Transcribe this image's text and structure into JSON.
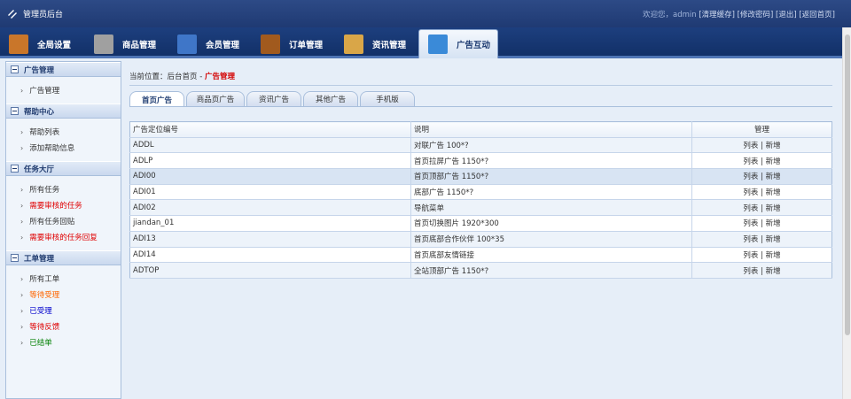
{
  "app": {
    "title": "管理员后台"
  },
  "toplinks": {
    "welcome": "欢迎您，admin",
    "clear_cache": "[清理缓存]",
    "change_pwd": "[修改密码]",
    "logout": "[退出]",
    "home": "[返回首页]"
  },
  "nav": {
    "tabs": [
      {
        "label": "全局设置",
        "icon": "house-icon",
        "color": "#c9762a"
      },
      {
        "label": "商品管理",
        "icon": "product-icon",
        "color": "#a0a0a0"
      },
      {
        "label": "会员管理",
        "icon": "member-card-icon",
        "color": "#3f76c8"
      },
      {
        "label": "订单管理",
        "icon": "briefcase-icon",
        "color": "#a15a1e"
      },
      {
        "label": "资讯管理",
        "icon": "folder-icon",
        "color": "#d9a648"
      },
      {
        "label": "广告互动",
        "icon": "window-icon",
        "color": "#3a8ad8"
      }
    ]
  },
  "sidebar": {
    "sections": [
      {
        "title": "广告管理",
        "items": [
          {
            "label": "广告管理",
            "color": "#333333"
          }
        ]
      },
      {
        "title": "帮助中心",
        "items": [
          {
            "label": "帮助列表",
            "color": "#333333"
          },
          {
            "label": "添加帮助信息",
            "color": "#333333"
          }
        ]
      },
      {
        "title": "任务大厅",
        "items": [
          {
            "label": "所有任务",
            "color": "#333333"
          },
          {
            "label": "需要审核的任务",
            "color": "#e00000"
          },
          {
            "label": "所有任务回贴",
            "color": "#333333"
          },
          {
            "label": "需要审核的任务回复",
            "color": "#e00000"
          }
        ]
      },
      {
        "title": "工单管理",
        "items": [
          {
            "label": "所有工单",
            "color": "#333333"
          },
          {
            "label": "等待受理",
            "color": "#ff6600"
          },
          {
            "label": "已受理",
            "color": "#0000cc"
          },
          {
            "label": "等待反馈",
            "color": "#e00000"
          },
          {
            "label": "已结单",
            "color": "#008000"
          }
        ]
      }
    ]
  },
  "breadcrumb": {
    "prefix": "当前位置：后台首页 - ",
    "current": "广告管理"
  },
  "subtabs": [
    "首页广告",
    "商品页广告",
    "资讯广告",
    "其他广告",
    "手机版"
  ],
  "table": {
    "headers": [
      "广告定位编号",
      "说明",
      "管理"
    ],
    "rows": [
      [
        "ADDL",
        "对联广告 100*?"
      ],
      [
        "ADLP",
        "首页拉屏广告 1150*?"
      ],
      [
        "ADI00",
        "首页顶部广告 1150*?"
      ],
      [
        "ADI01",
        "底部广告 1150*?"
      ],
      [
        "ADI02",
        "导航菜单"
      ],
      [
        "jiandan_01",
        "首页切换图片 1920*300"
      ],
      [
        "ADI13",
        "首页底部合作伙伴 100*35"
      ],
      [
        "ADI14",
        "首页底部友情链接"
      ],
      [
        "ADTOP",
        "全站顶部广告 1150*?"
      ]
    ],
    "action_list": "列表",
    "action_sep": " | ",
    "action_add": "新增"
  }
}
